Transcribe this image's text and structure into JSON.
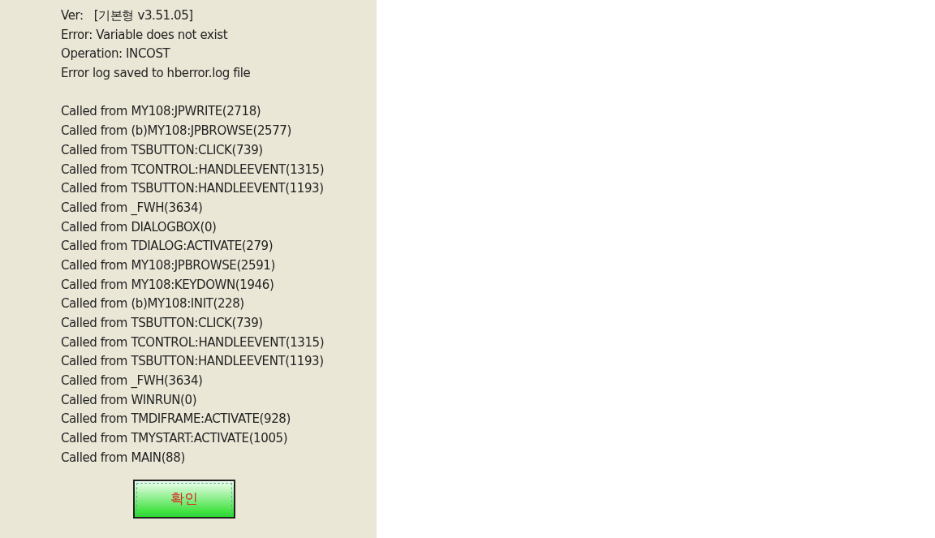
{
  "header_lines": [
    "Ver:   [기본형 v3.51.05]",
    "Error: Variable does not exist",
    "Operation: INCOST",
    "Error log saved to hberror.log file"
  ],
  "call_stack": [
    "Called from MY108:JPWRITE(2718)",
    "Called from (b)MY108:JPBROWSE(2577)",
    "Called from TSBUTTON:CLICK(739)",
    "Called from TCONTROL:HANDLEEVENT(1315)",
    "Called from TSBUTTON:HANDLEEVENT(1193)",
    "Called from _FWH(3634)",
    "Called from DIALOGBOX(0)",
    "Called from TDIALOG:ACTIVATE(279)",
    "Called from MY108:JPBROWSE(2591)",
    "Called from MY108:KEYDOWN(1946)",
    "Called from (b)MY108:INIT(228)",
    "Called from TSBUTTON:CLICK(739)",
    "Called from TCONTROL:HANDLEEVENT(1315)",
    "Called from TSBUTTON:HANDLEEVENT(1193)",
    "Called from _FWH(3634)",
    "Called from WINRUN(0)",
    "Called from TMDIFRAME:ACTIVATE(928)",
    "Called from TMYSTART:ACTIVATE(1005)",
    "Called from MAIN(88)"
  ],
  "ok_button": "확인"
}
